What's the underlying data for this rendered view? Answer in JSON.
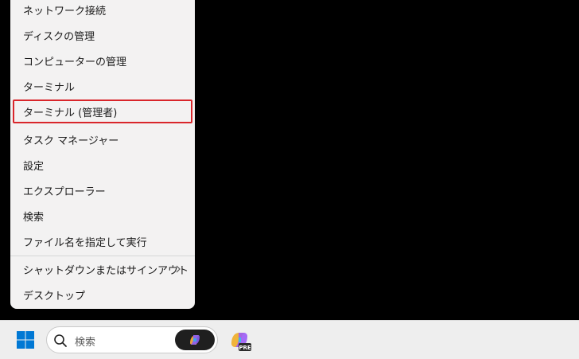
{
  "context_menu": {
    "items": [
      {
        "label": "ネットワーク接続"
      },
      {
        "label": "ディスクの管理"
      },
      {
        "label": "コンピューターの管理"
      },
      {
        "label": "ターミナル"
      },
      {
        "label": "ターミナル (管理者)",
        "highlighted": true
      },
      {
        "label": "タスク マネージャー"
      },
      {
        "label": "設定"
      },
      {
        "label": "エクスプローラー"
      },
      {
        "label": "検索"
      },
      {
        "label": "ファイル名を指定して実行"
      },
      {
        "label": "シャットダウンまたはサインアウト",
        "submenu": true
      },
      {
        "label": "デスクトップ"
      }
    ]
  },
  "taskbar": {
    "start_icon": "windows-logo-icon",
    "search": {
      "icon": "search-icon",
      "placeholder": "検索"
    },
    "copilot_icon": "copilot-icon",
    "copilot_pre_badge": "PRE"
  },
  "colors": {
    "highlight_border": "#d9262b",
    "menu_bg": "#f3f2f2",
    "taskbar_bg": "#eeeeee",
    "windows_blue": "#0078d4"
  }
}
